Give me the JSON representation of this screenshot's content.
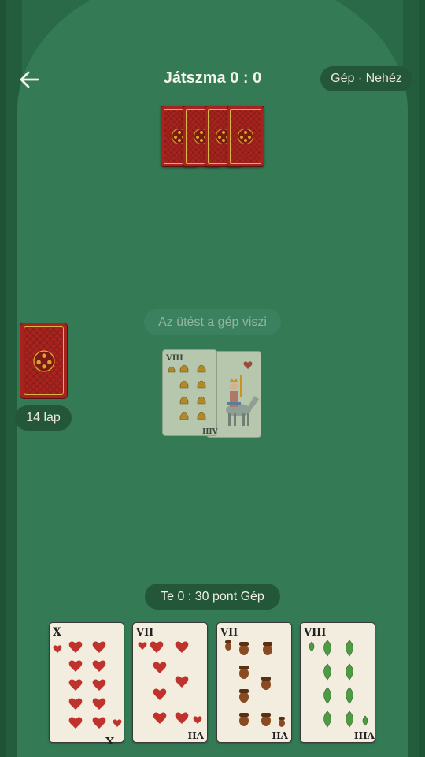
{
  "header": {
    "title": "Játszma  0 : 0",
    "mode": "Gép · Nehéz"
  },
  "opponent_hand": {
    "cards": 4
  },
  "deck": {
    "count_label": "14 lap"
  },
  "status": {
    "message": "Az ütést a gép viszi"
  },
  "trick": [
    {
      "rank": "VIII",
      "suit": "bells"
    },
    {
      "rank": "horseman",
      "suit": "hearts"
    }
  ],
  "score": {
    "label": "Te  0 : 30 pont  Gép"
  },
  "hand": [
    {
      "rank": "X",
      "suit": "hearts"
    },
    {
      "rank": "VII",
      "suit": "hearts"
    },
    {
      "rank": "VII",
      "suit": "acorns"
    },
    {
      "rank": "VIII",
      "suit": "leaves"
    }
  ],
  "colors": {
    "felt": "#337a55",
    "card_back": "#a8231e",
    "hearts": "#c0322c",
    "acorns": "#8a4a22",
    "leaves": "#4e9a45",
    "bells": "#c9951e"
  }
}
